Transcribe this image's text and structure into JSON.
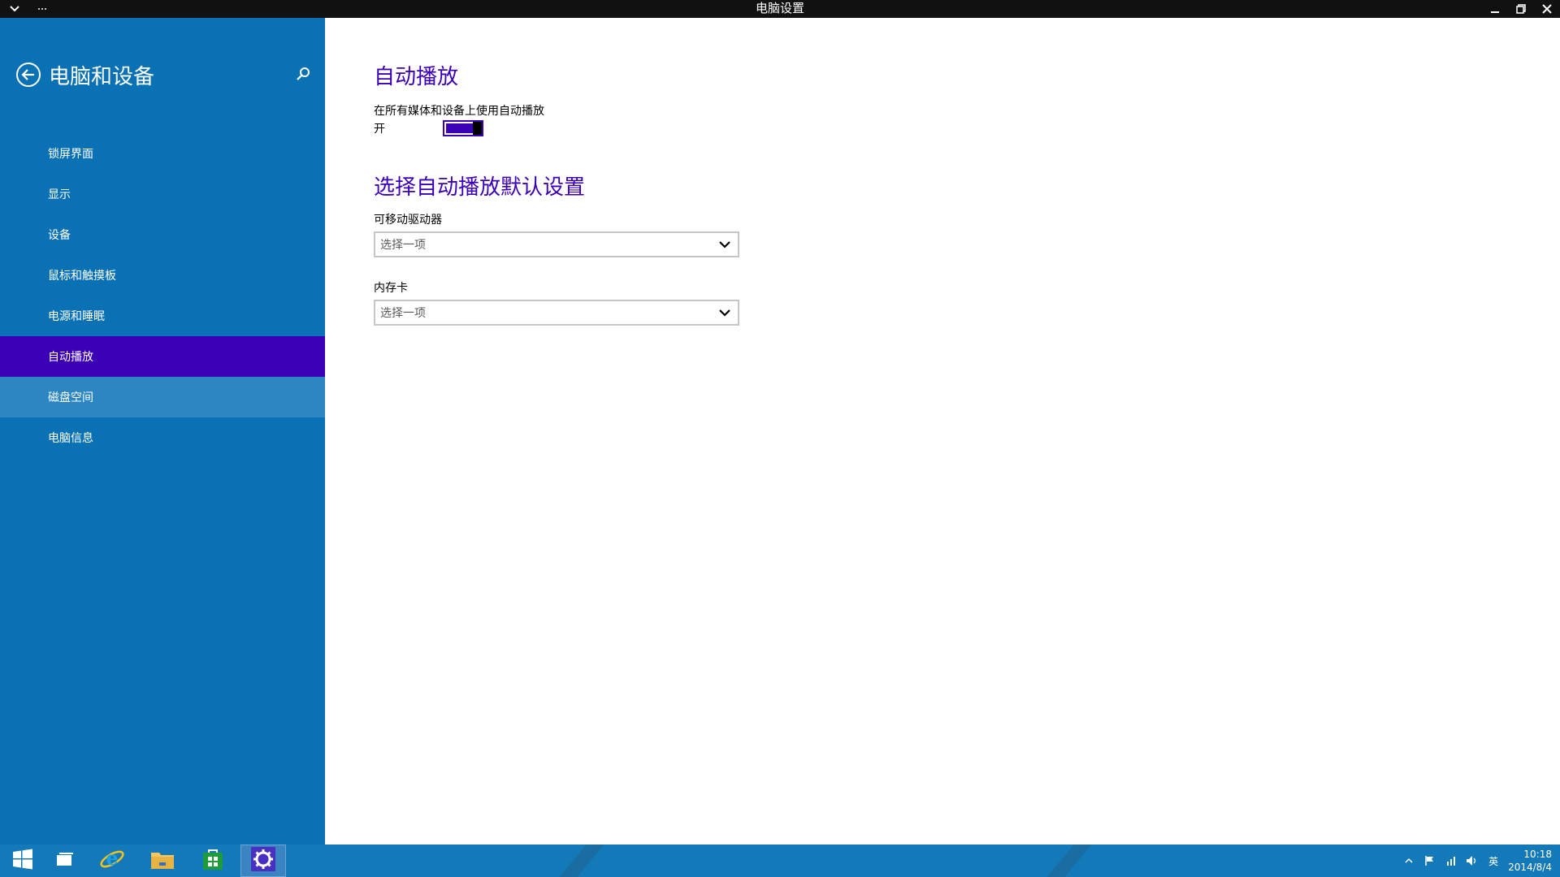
{
  "window": {
    "title": "电脑设置"
  },
  "sidebar": {
    "title": "电脑和设备",
    "items": [
      {
        "label": "锁屏界面"
      },
      {
        "label": "显示"
      },
      {
        "label": "设备"
      },
      {
        "label": "鼠标和触摸板"
      },
      {
        "label": "电源和睡眠"
      },
      {
        "label": "自动播放",
        "selected": true
      },
      {
        "label": "磁盘空间",
        "hovered": true
      },
      {
        "label": "电脑信息"
      }
    ]
  },
  "main": {
    "heading": "自动播放",
    "autoplay_description": "在所有媒体和设备上使用自动播放",
    "toggle_state_label": "开",
    "toggle_on": true,
    "defaults_heading": "选择自动播放默认设置",
    "removable_drive": {
      "label": "可移动驱动器",
      "value": "选择一项"
    },
    "memory_card": {
      "label": "内存卡",
      "value": "选择一项"
    }
  },
  "taskbar": {
    "apps": [
      "start-icon",
      "task-view-icon",
      "internet-explorer-icon",
      "file-explorer-icon",
      "store-icon",
      "settings-icon"
    ],
    "tray": {
      "input_method": "英",
      "time": "10:18",
      "date": "2014/8/4"
    }
  },
  "colors": {
    "accent": "#3b00b6",
    "sidebar_bg": "#0a71b4",
    "taskbar_bg": "#1479b8",
    "titlebar_bg": "#111111"
  }
}
